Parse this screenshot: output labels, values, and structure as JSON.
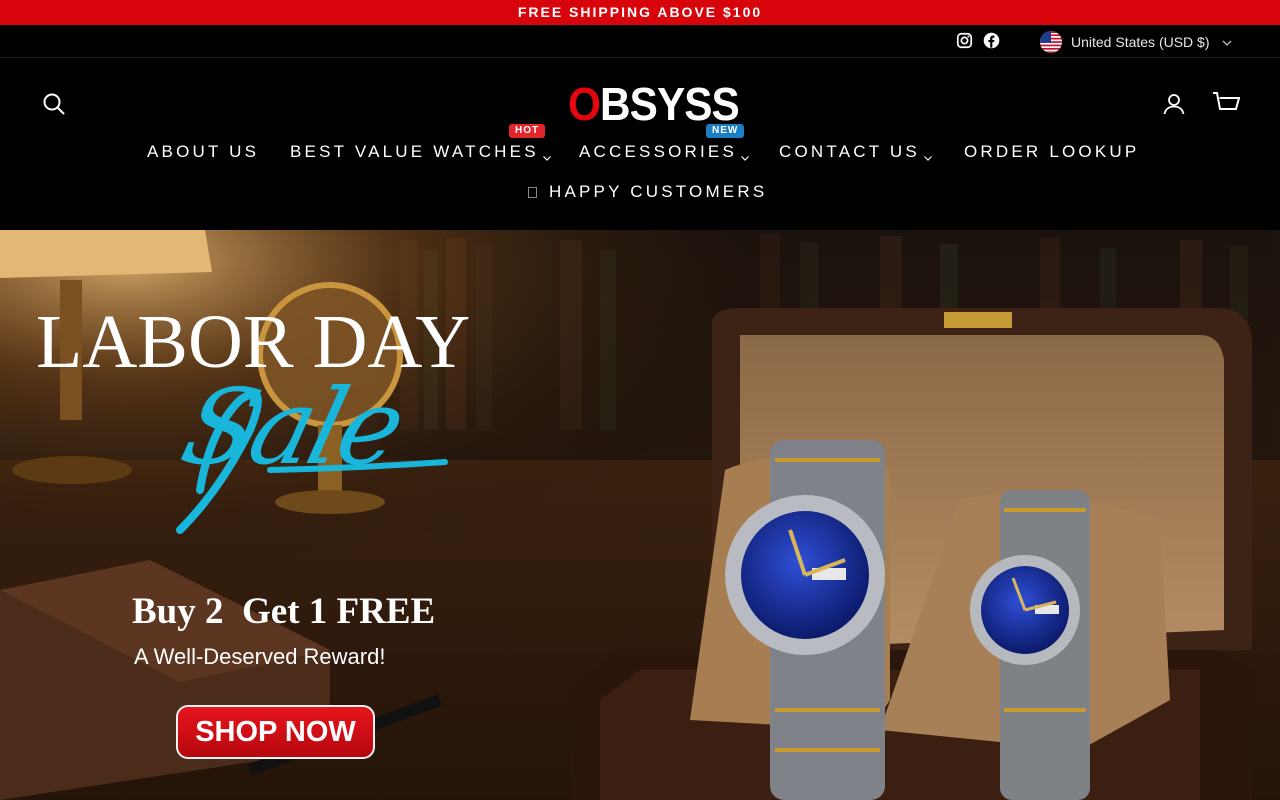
{
  "announcement": {
    "text": "FREE SHIPPING ABOVE $100"
  },
  "utility_bar": {
    "social_icons": [
      "instagram-icon",
      "facebook-icon"
    ],
    "currency_label": "United States (USD $)"
  },
  "header": {
    "logo": {
      "first_letter": "O",
      "rest": "BSYSS"
    },
    "icons": [
      "search-icon",
      "account-icon",
      "cart-icon"
    ]
  },
  "nav": {
    "items": [
      {
        "label": "ABOUT US",
        "dropdown": false
      },
      {
        "label": "BEST VALUE WATCHES",
        "dropdown": true,
        "badge": "HOT"
      },
      {
        "label": "ACCESSORIES",
        "dropdown": true,
        "badge": "NEW"
      },
      {
        "label": "CONTACT US",
        "dropdown": true
      },
      {
        "label": "ORDER LOOKUP",
        "dropdown": false
      }
    ],
    "row2_label": "HAPPY CUSTOMERS"
  },
  "hero": {
    "headline": "LABOR DAY",
    "script_word": "Sale",
    "offer": "Buy 2  Get 1 FREE",
    "subline": "A Well-Deserved Reward!",
    "cta_label": "SHOP NOW"
  },
  "colors": {
    "announcement_bg": "#d8040c",
    "logo_accent": "#e3060f",
    "hot_badge": "#e3252c",
    "new_badge": "#1b7fc6",
    "script_accent": "#19b6dc",
    "cta_bg": "#d40e16"
  }
}
